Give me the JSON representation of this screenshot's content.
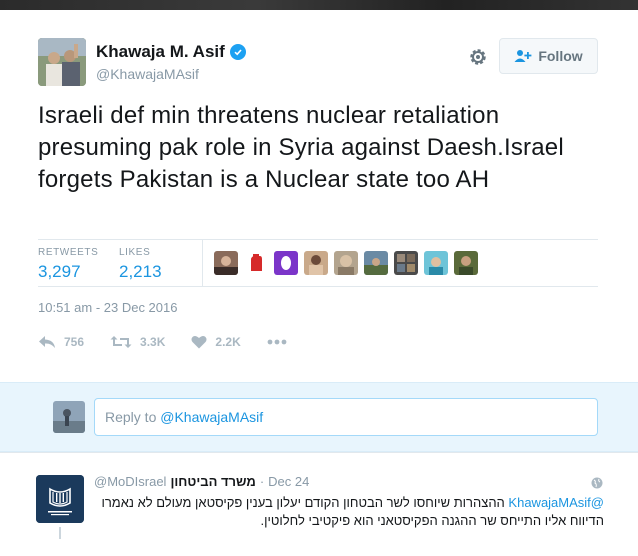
{
  "tweet": {
    "author_name": "Khawaja M. Asif",
    "author_handle": "@KhawajaMAsif",
    "follow_label": "Follow",
    "text": "Israeli def min threatens nuclear retaliation presuming pak role in Syria against Daesh.Israel forgets Pakistan is a Nuclear state too AH",
    "retweets_label": "RETWEETS",
    "retweets_value": "3,297",
    "likes_label": "LIKES",
    "likes_value": "2,213",
    "timestamp": "10:51 am - 23 Dec 2016",
    "actions": {
      "reply_count": "756",
      "retweet_count": "3.3K",
      "like_count": "2.2K"
    }
  },
  "reply_box": {
    "prefix": "Reply to ",
    "mention": "@KhawajaMAsif"
  },
  "reply_tweet": {
    "author_name": "משרד הביטחון",
    "author_handle": "@MoDIsrael",
    "separator": "·",
    "date": "Dec 24",
    "mention": "@KhawajaMAsif",
    "text": " ההצהרות שיוחסו לשר הבטחון הקודם יעלון בענין פקיסטאן מעולם לא נאמרו הדיווח אליו התייחס שר ההגנה הפקיסטאני הוא פיקטיבי לחלוטין."
  },
  "colors": {
    "link": "#1b95e0",
    "muted": "#8899a6",
    "verified": "#1da1f2",
    "reply_bar_bg": "#e8f5fd"
  },
  "icons": [
    "settings-gear-icon",
    "follow-person-plus-icon",
    "verified-badge-icon",
    "reply-arrow-icon",
    "retweet-icon",
    "heart-icon",
    "more-dots-icon",
    "globe-icon"
  ]
}
